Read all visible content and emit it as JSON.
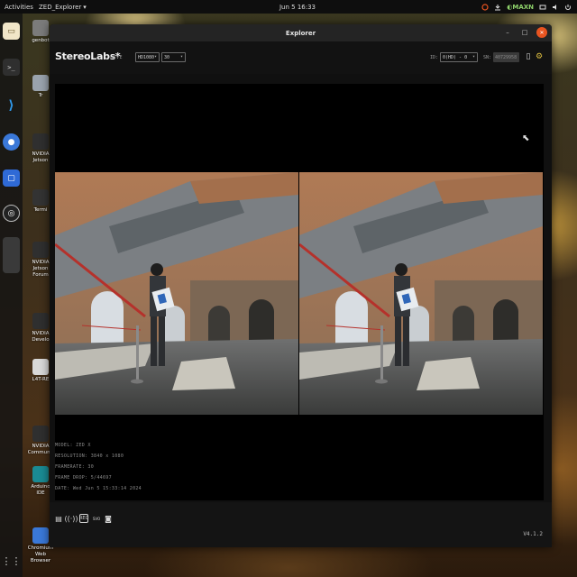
{
  "topbar": {
    "activities": "Activities",
    "app_name": "ZED_Explorer",
    "app_arrow": "▾",
    "clock": "Jun 5  16:33",
    "power_mode": "MAXN"
  },
  "desktop_icons": [
    {
      "label": "genbot",
      "color": "#7b7b7b"
    },
    {
      "label": "Tr",
      "color": "#9aa3ad"
    },
    {
      "label": "NVIDIA Jetson",
      "color": "#2f2f2f"
    },
    {
      "label": "Termi",
      "color": "#333333"
    },
    {
      "label": "NVIDIA Jetson Forum",
      "color": "#2f2f2f"
    },
    {
      "label": "NVIDIA Develo",
      "color": "#2f2f2f"
    },
    {
      "label": "L4T-RE",
      "color": "#d8d8d8"
    },
    {
      "label": "NVIDIA Communit",
      "color": "#2f2f2f"
    },
    {
      "label": "Arduino IDE",
      "color": "#1a8a93"
    },
    {
      "label": "Chromium Web Browser",
      "color": "#3a78d8"
    }
  ],
  "window": {
    "title": "Explorer",
    "minimize": "–",
    "maximize": "□",
    "close": "✕"
  },
  "header": {
    "logo": "StereoLabs*",
    "live": "LIVE",
    "resolution": "HD1080",
    "fps": "30",
    "id_label": "ID:",
    "camera_id": "0(HD) - 0",
    "sn_label": "SN:",
    "serial": "40729958"
  },
  "info": {
    "model": "MODEL: ZED X",
    "resolution": "RESOLUTION: 3840 x 1080",
    "framerate": "FRAMERATE: 30",
    "frame_drop": "FRAME DROP: 5/44697",
    "date": "DATE: Wed Jun 5 15:33:14 2024"
  },
  "footer": {
    "record": "REC",
    "svo": "SVO",
    "version": "V4.1.2"
  }
}
